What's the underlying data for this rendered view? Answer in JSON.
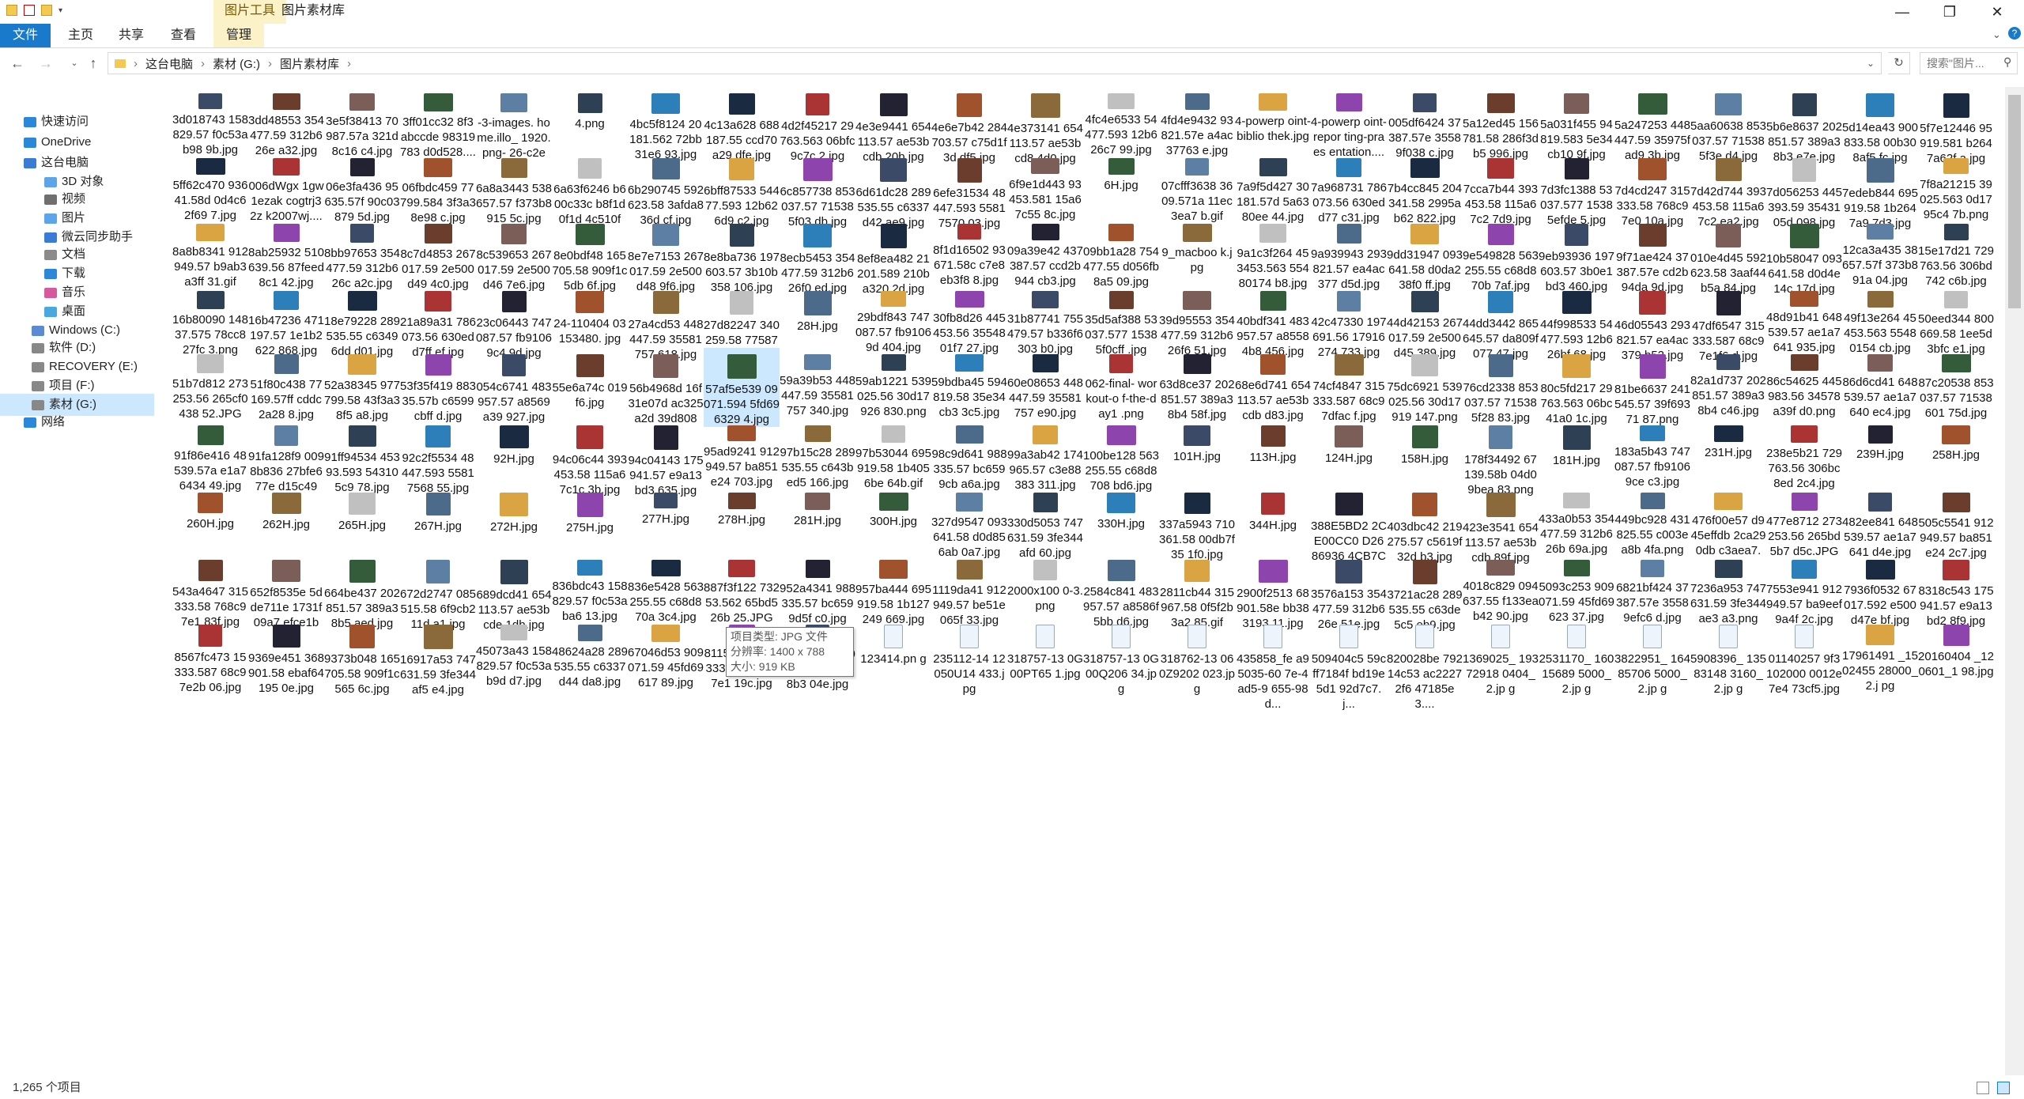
{
  "titlebar": {
    "tools_label": "图片工具",
    "window_title": "图片素材库",
    "minimize": "—",
    "maximize": "❐",
    "close": "✕"
  },
  "ribbon": {
    "tabs": [
      "文件",
      "主页",
      "共享",
      "查看",
      "管理"
    ]
  },
  "address": {
    "path": [
      "这台电脑",
      "素材 (G:)",
      "图片素材库"
    ],
    "search_placeholder": "搜索\"图片..."
  },
  "sidebar": {
    "items": [
      "快速访问",
      "OneDrive",
      "这台电脑",
      "3D 对象",
      "视频",
      "图片",
      "微云同步助手",
      "文档",
      "下载",
      "音乐",
      "桌面",
      "Windows (C:)",
      "软件 (D:)",
      "RECOVERY (E:)",
      "项目 (F:)",
      "素材 (G:)",
      "网络"
    ]
  },
  "colors": {
    "accent": "#1979ca",
    "tools_bg": "#fcf2c8",
    "selection": "#cce8ff"
  },
  "tooltip": {
    "lines": [
      "项目类型: JPG 文件",
      "分辨率: 1400 x 788",
      "大小: 919 KB"
    ]
  },
  "status": {
    "count": "1,265 个项目"
  },
  "files": [
    [
      "3d018743 158829.57 f0c53ab98 9b.jpg",
      "3dd48553 354477.59 312b626e a32.jpg",
      "3e5f38413 70987.57a 321d8c16 c4.jpg",
      "3ff01cc32 8f3abccde 98319783 d0d528....",
      "-3-images. home.illo_ 1920.png- 26-c2ec...",
      "4.png",
      "4bc5f8124 20181.562 72bb31e6 93.jpg",
      "4c13a628 688187.55 ccd70a29 dfe.jpg",
      "4d2f45217 29763.563 06bfc9c7c 2.jpg",
      "4e3e9441 654113.57 ae53bcdb 20b.jpg",
      "4e6e7b42 284703.57 c75d1f3d df5.jpg",
      "4e373141 654113.57 ae53bcd8 4d0.jpg",
      "4fc4e6533 54477.593 12b626c7 99.jpg",
      "4fd4e9432 93821.57e a4ac37763 e.jpg",
      "4-powerp oint-biblio thek.jpg",
      "4-powerp oint-repor ting-praes entation....",
      "005df6424 37387.57e 35589f038 c.jpg",
      "5a12ed45 156781.58 286f3db5 996.jpg",
      "5a031f455 94819.583 5e34cb10 9f.jpg",
      "5a247253 448447.59 35975fad9 3b.jpg",
      "5aa60638 853037.57 715385f3e d4.jpg",
      "5b6e8637 202851.57 389a38b3 e7e.jpg",
      "5d14ea43 900833.58 00b308af5 fc.jpg",
      "5f7e12446 95919.581 b2647a62f a.jpg"
    ],
    [
      "5ff62c470 93641.58d 0d4c62f69 7.jpg",
      "006dWgx 1gw1ezak cogtrj32z k2007wj....",
      "06e3fa436 95635.57f 90c03879 5d.jpg",
      "06fbdc459 77799.584 3f3a38e98 c.jpg",
      "6a8a3443 538657.57 f373b8915 5c.jpg",
      "6a63f6246 b600c33c b8f1d0f1d 4c510fd...",
      "6b290745 592623.58 3afda836d cf.jpg",
      "6bff87533 54477.593 12b626d9 c2.jpg",
      "6c857738 853037.57 715385f03 db.jpg",
      "6d61dc28 289535.55 c6337d42 ae9.jpg",
      "6efe31534 48447.593 55817570 03.jpg",
      "6f9e1d443 93453.581 15a67c55 8c.jpg",
      "6H.jpg",
      "07cfff3638 3609.571a 11ec3ea7 b.gif",
      "7a9f5d427 30181.57d 5a6380ee 44.jpg",
      "7a968731 786073.56 630edd77 c31.jpg",
      "7b4cc845 204341.58 2995ab62 822.jpg",
      "7cca7b44 393453.58 115a67c2 7d9.jpg",
      "7d3fc1388 53037.577 15385efde 5.jpg",
      "7d4cd247 315333.58 768c97e0 10a.jpg",
      "7d42d744 393453.58 115a67c2 ea2.jpg",
      "7d056253 445393.59 3543105d 098.jpg",
      "7edeb844 695919.58 1b2647a9 7d3.jpg",
      "7f8a21215 39025.563 0d1795c4 7b.png"
    ],
    [
      "8a8b8341 912949.57 b9ab3a3ff 31.gif",
      "8ab25932 510639.56 87feed8c1 42.jpg",
      "8bb97653 354477.59 312b626c a2c.jpg",
      "8c7d4853 267017.59 2e500d49 4c0.jpg",
      "8c539653 267017.59 2e500d46 7e6.jpg",
      "8e0bdf48 165705.58 909f1c5db 6f.jpg",
      "8e7e7153 267017.59 2e500d48 9f6.jpg",
      "8e8ba736 197603.57 3b10b358 106.jpg",
      "8ecb5453 354477.59 312b626f0 ed.jpg",
      "8ef8ea482 21201.589 210ba320 2d.jpg",
      "8f1d16502 93671.58c c7e8eb3f8 8.jpg",
      "09a39e42 437387.57 ccd2b944 cb3.jpg",
      "09bb1a28 754477.55 d056fb8a5 09.jpg",
      "9_macboo k.jpg",
      "9a1c3f264 453453.563 55480174 b8.jpg",
      "9a939943 293821.57 ea4ac377 d5d.jpg",
      "9dd31947 093641.58 d0da238f0 ff.jpg",
      "9e549828 563255.55 c68d870b 7af.jpg",
      "9eb93936 197603.57 3b0e1bd3 460.jpg",
      "9f71ae424 37387.57e cd2b94da 9d.jpg",
      "010e4d45 592623.58 3aaf44b5a 84.jpg",
      "10b58047 093641.58 d0d4e14c 17d.jpg",
      "12ca3a435 38657.57f 373b891a 04.jpg",
      "15e17d21 729763.56 306bd742 c6b.jpg"
    ],
    [
      "16b80090 14837.575 78cc827fc 3.png",
      "16b47236 471197.57 1e1b2622 868.jpg",
      "18e79228 289535.55 c63496dd d01.jpg",
      "21a89a31 786073.56 630edd7ff ef.jpg",
      "23c06443 747087.57 fb91069c4 9d.jpg",
      "24-110404 03153480. jpg",
      "27a4cd53 448447.59 35581757 618.jpg",
      "27d82247 340259.58 7758733b 52d.jpg",
      "28H.jpg",
      "29bdf843 747087.57 fb91069d 404.jpg",
      "30fb8d26 445453.56 3554801f7 27.jpg",
      "31b87741 755479.57 b336f6303 b0.jpg",
      "35d5af388 53037.577 15385f0cff .jpg",
      "39d95553 354477.59 312b626f6 51.jpg",
      "40bdf341 483957.57 a85584b8 456.jpg",
      "42c47330 197691.56 17916274 733.jpg",
      "44d42153 267017.59 2e500d45 389.jpg",
      "44dd3442 865645.57 da809f077 47.jpg",
      "44f998533 54477.593 12b626bf 68.jpg",
      "46d05543 293821.57 ea4ac379 b52.jpg",
      "47df6547 315333.587 68c97e1f6 d.jpg",
      "48d91b41 648539.57 ae1a7641 935.jpg",
      "49f13e264 45453.563 55480154 cb.jpg",
      "50eed344 800669.58 1ee5d3bfc e1.jpg"
    ],
    [
      "51b7d812 273253.56 265cf0438 52.JPG",
      "51f80c438 77169.57ff cddc2a28 8.jpg",
      "52a38345 977799.58 43f3a38f5 a8.jpg",
      "53f35f419 88335.57b c6599cbff d.jpg",
      "054c6741 483957.57 a8569a39 927.jpg",
      "55e6a74c 019f6.jpg",
      "56b4968d 16f31e07d ac325a2d 39d8085....",
      "57af5e539 09071.594 5fd696329 4.jpg",
      "59a39b53 448447.59 35581757 340.jpg",
      "59ab1221 539025.56 30d17926 830.png",
      "59bdba45 594819.58 35e34cb3 3c5.jpg",
      "60e08653 448447.59 35581757 e90.jpg",
      "062-final- workout-o f-the-day1 .png",
      "63d8ce37 202851.57 389a38b4 58f.jpg",
      "68e6d741 654113.57 ae53bcdb d83.jpg",
      "74cf4847 315333.587 68c97dfac f.jpg",
      "75dc6921 539025.56 30d17919 147.png",
      "76cd2338 853037.57 715385f28 83.jpg",
      "80c5fd217 29763.563 06bc41a0 1c.jpg",
      "81be6637 241545.57 39f69371 87.png",
      "82a1d737 202851.57 389a38b4 c46.jpg",
      "86c54625 445983.56 34578a39f d0.png",
      "86d6cd41 648539.57 ae1a7640 ec4.jpg",
      "87c20538 853037.57 71538601 75d.jpg"
    ],
    [
      "91f86e416 48539.57a e1a76434 49.jpg",
      "91fa128f9 0098b836 27bfe677e d15c49_....",
      "91ff94534 45393.593 543105c9 78.jpg",
      "92c2f5534 48447.593 55817568 55.jpg",
      "92H.jpg",
      "94c06c44 393453.58 115a67c1c 3b.jpg",
      "94c04143 175941.57 e9a13bd3 635.jpg",
      "95ad9241 912949.57 ba851e24 703.jpg",
      "97b15c28 289535.55 c643bed5 166.jpg",
      "97b53044 695919.58 1b4056be 64b.gif",
      "98c9d641 988335.57 bc6599cb a6a.jpg",
      "99a3ab42 174965.57 c3e88383 311.jpg",
      "100be128 563255.55 c68d8708 bd6.jpg",
      "101H.jpg",
      "113H.jpg",
      "124H.jpg",
      "158H.jpg",
      "178f34492 67139.58b 04d09bea 83.png",
      "181H.jpg",
      "183a5b43 747087.57 fb91069ce c3.jpg",
      "231H.jpg",
      "238e5b21 729763.56 306bc8ed 2c4.jpg",
      "239H.jpg",
      "258H.jpg"
    ],
    [
      "260H.jpg",
      "262H.jpg",
      "265H.jpg",
      "267H.jpg",
      "272H.jpg",
      "275H.jpg",
      "277H.jpg",
      "278H.jpg",
      "281H.jpg",
      "300H.jpg",
      "327d9547 093641.58 d0d856ab 0a7.jpg",
      "330d5053 747631.59 3fe344afd 60.jpg",
      "330H.jpg",
      "337a5943 710361.58 00db7f35 1f0.jpg",
      "344H.jpg",
      "388E5BD2 2CE00CC0 D2686936 4CB7C49....",
      "403dbc42 219275.57 c5619f32d b3.jpg",
      "423e3541 654113.57 ae53bcdb 89f.jpg",
      "433a0b53 354477.59 312b626b 69a.jpg",
      "449bc928 431825.55 c003ea8b 4fa.png",
      "476f00e57 d945effdb 2ca290db c3aea7.j...",
      "477e8712 273253.56 265bd5b7 d5c.JPG",
      "482ee841 648539.57 ae1a7641 d4e.jpg",
      "505c5541 912949.57 ba851e24 2c7.jpg"
    ],
    [
      "543a4647 315333.58 768c97e1 83f.jpg",
      "652f8535e 5dde711e 1731f09a7 efce1b9....",
      "664be437 202851.57 389a38b5 aed.jpg",
      "672d2747 085515.58 6f9cb211d a1.jpg",
      "689dcd41 654113.57 ae53bcde 1db.jpg",
      "836bdc43 158829.57 f0c53aba6 13.jpg",
      "836e5428 563255.55 c68d870a 3c4.jpg",
      "887f3f122 73253.562 65bd526b 25.JPG",
      "952a4341 988335.57 bc6599d5f c0.jpg",
      "957ba444 695919.58 1b127249 669.jpg",
      "1119da41 912949.57 be51e065f 33.jpg",
      "2000x100 0-3.png",
      "2584c841 483957.57 a8586f5bb d6.jpg",
      "2811cb44 315967.58 0f5f2b3a2 85.gif",
      "2900f2513 68901.58e bb383193 11.jpg",
      "3576a153 354477.59 312b626e 51e.jpg",
      "3721ac28 289535.55 c63de5c5 eb9.jpg",
      "4018c829 094637.55 f133eab42 90.jpg",
      "5093c253 909071.59 45fd69623 37.jpg",
      "6821bf424 37387.57e 35589efc6 d.jpg",
      "7236a953 747631.59 3fe344ae3 a3.png",
      "7553e941 912949.57 ba9eef9a4f 2c.jpg",
      "7936f0532 67017.592 e500d47e bf.jpg",
      "8318c543 175941.57 e9a13bd2 8f9.jpg"
    ],
    [
      "8567fc473 15333.587 68c97e2b 06.jpg",
      "9369e451 368901.58 ebaf64195 0e.jpg",
      "9373b048 165705.58 909f1c565 6c.jpg",
      "16917a53 747631.59 3fe344af5 e4.jpg",
      "45073a43 158829.57 f0c53ab9d d7.jpg",
      "48624a28 289535.55 c6337d44 da8.jpg",
      "67046d53 909071.59 45fd69617 89.jpg",
      "81154b47 315333.58 768c97e1 19c.jpg",
      "90529d17 179851.58 0a30b8b3 04e.jpg",
      "123414.pn g",
      "235112-14 12050U14 433.jpg",
      "318757-13 0G00PT65 1.jpg",
      "318757-13 0G00Q206 34.jpg",
      "318762-13 060Z9202 023.jpg",
      "435858_fe a95035-60 7e-4ad5-9 655-98d...",
      "509404c5 59cff7184f bd19e5d1 92d7c7.j...",
      "820028be 79214c53 ac22272f6 47185e3....",
      "1369025_ 19372918 0404_2.jp g",
      "2531170_ 16015689 5000_2.jp g",
      "3822951_ 16485706 5000_2.jp g",
      "5908396_ 13583148 3160_2.jp g",
      "01140257 9f3102000 0012e7e4 73cf5.jpg",
      "17961491 _1502455 28000_2.j pg",
      "20160404 _120601_1 98.jpg"
    ]
  ]
}
